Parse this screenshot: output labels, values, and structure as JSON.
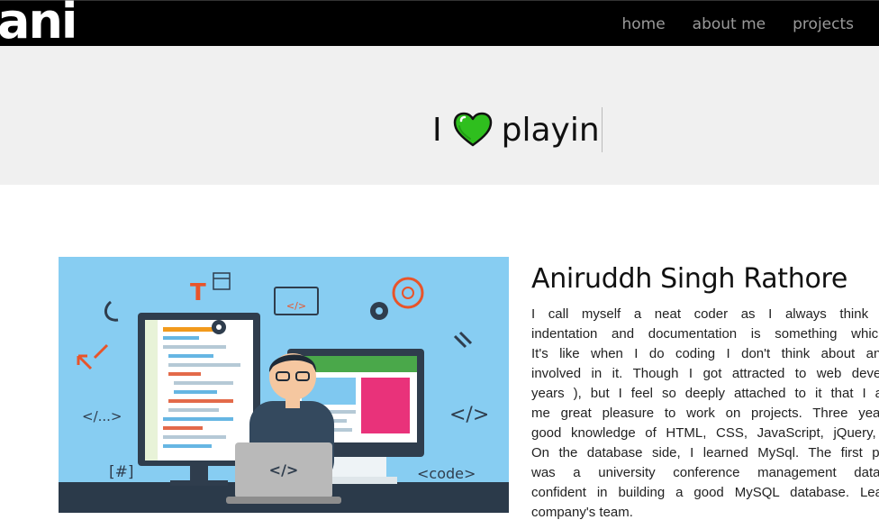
{
  "nav": {
    "logo": "ani",
    "links": [
      {
        "label": "home"
      },
      {
        "label": "about me"
      },
      {
        "label": "projects"
      }
    ]
  },
  "hero": {
    "prefix": "I",
    "icon": "green-heart-icon",
    "typed": "playin"
  },
  "about": {
    "image_icon": "developer-illustration",
    "image_texts": {
      "t": "T",
      "code_tag": "</>",
      "code_dots": "</...>",
      "hash": "[#]",
      "code_word": "<code>",
      "tag_big": "</>",
      "laptop_tag": "</>"
    },
    "name": "Aniruddh Singh Rathore",
    "bio_lines": [
      "I call myself a neat coder as I always think a p",
      "indentation and documentation is something which is",
      "It's like when I do coding I don't think about anythin",
      "involved in it. Though I got attracted to web developin",
      "years ), but I feel so deeply attached to it that I alway",
      "me great pleasure to work on projects. Three years o",
      "good knowledge of HTML, CSS, JavaScript, jQuery, Boo",
      "On the database side, I learned MySql. The first profes",
      "was a university conference management database",
      "confident in building a good MySQL database. Learned",
      "company's team."
    ]
  },
  "colors": {
    "navbar": "#000000",
    "hero_bg": "#f0f0f0",
    "heart": "#2fbf1e",
    "image_bg": "#87cdf2",
    "nav_link": "#9a9a9a"
  }
}
